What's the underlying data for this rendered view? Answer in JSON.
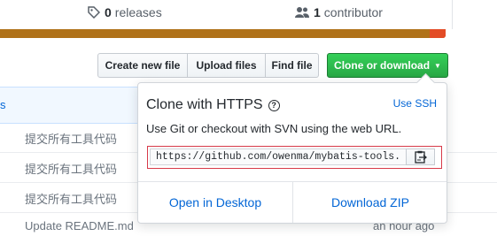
{
  "stats": {
    "releases_count": "0",
    "releases_label": "releases",
    "contributors_count": "1",
    "contributors_label": "contributor"
  },
  "language_colors": {
    "primary": "#b07219",
    "secondary": "#e34c26"
  },
  "toolbar": {
    "create_file": "Create new file",
    "upload_files": "Upload files",
    "find_file": "Find file",
    "clone_download": "Clone or download"
  },
  "file_header_partial": "s",
  "commits": [
    {
      "message": "提交所有工具代码"
    },
    {
      "message": "提交所有工具代码"
    },
    {
      "message": "提交所有工具代码"
    },
    {
      "message": "Update README.md",
      "time": "an hour ago"
    }
  ],
  "clone_popover": {
    "title": "Clone with HTTPS",
    "use_ssh": "Use SSH",
    "description": "Use Git or checkout with SVN using the web URL.",
    "url": "https://github.com/owenma/mybatis-tools.gi",
    "open_desktop": "Open in Desktop",
    "download_zip": "Download ZIP"
  },
  "colors": {
    "accent": "#0366d6",
    "clone_button": "#28a745",
    "highlight_border": "#d73a49"
  }
}
